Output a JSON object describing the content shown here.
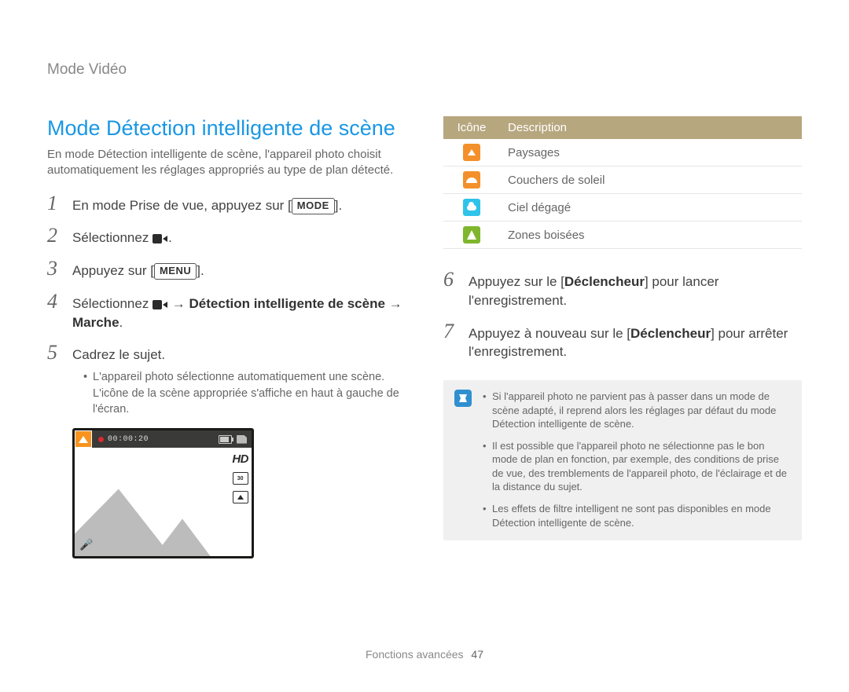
{
  "section_label": "Mode Vidéo",
  "title": "Mode Détection intelligente de scène",
  "intro": "En mode Détection intelligente de scène, l'appareil photo choisit automatiquement les réglages appropriés au type de plan détecté.",
  "inline_labels": {
    "mode": "MODE",
    "menu": "MENU"
  },
  "steps_left": [
    {
      "n": "1",
      "before": "En mode Prise de vue, appuyez sur [",
      "after": "]."
    },
    {
      "n": "2",
      "before": "Sélectionnez ",
      "after": "."
    },
    {
      "n": "3",
      "before": "Appuyez sur [",
      "after": "]."
    },
    {
      "n": "4",
      "before": "Sélectionnez ",
      "bold": "Détection intelligente de scène",
      "after2": " → ",
      "bold2": "Marche",
      "tail": "."
    },
    {
      "n": "5",
      "before": "Cadrez le sujet."
    }
  ],
  "substep5": "L'appareil photo sélectionne automatiquement une scène. L'icône de la scène appropriée s'affiche en haut à gauche de l'écran.",
  "lcd": {
    "time": "00:00:20",
    "hd": "HD",
    "fps": "30"
  },
  "table": {
    "head_icon": "Icône",
    "head_desc": "Description",
    "rows": [
      {
        "icon": "landscape",
        "color": "orange",
        "label": "Paysages"
      },
      {
        "icon": "sunset",
        "color": "orange",
        "label": "Couchers de soleil"
      },
      {
        "icon": "sky",
        "color": "cyan",
        "label": "Ciel dégagé"
      },
      {
        "icon": "forest",
        "color": "green",
        "label": "Zones boisées"
      }
    ]
  },
  "steps_right": [
    {
      "n": "6",
      "pre": "Appuyez sur le [",
      "bold": "Déclencheur",
      "post": "] pour lancer l'enregistrement."
    },
    {
      "n": "7",
      "pre": "Appuyez à nouveau sur le [",
      "bold": "Déclencheur",
      "post": "] pour arrêter l'enregistrement."
    }
  ],
  "notes": [
    "Si l'appareil photo ne parvient pas à passer dans un mode de scène adapté, il reprend alors les réglages par défaut du mode Détection intelligente de scène.",
    "Il est possible que l'appareil photo ne sélectionne pas le bon mode de plan en fonction, par exemple, des conditions de prise de vue, des tremblements de l'appareil photo, de l'éclairage et de la distance du sujet.",
    "Les effets de filtre intelligent ne sont pas disponibles en mode Détection intelligente de scène."
  ],
  "footer": {
    "section": "Fonctions avancées",
    "page": "47"
  }
}
